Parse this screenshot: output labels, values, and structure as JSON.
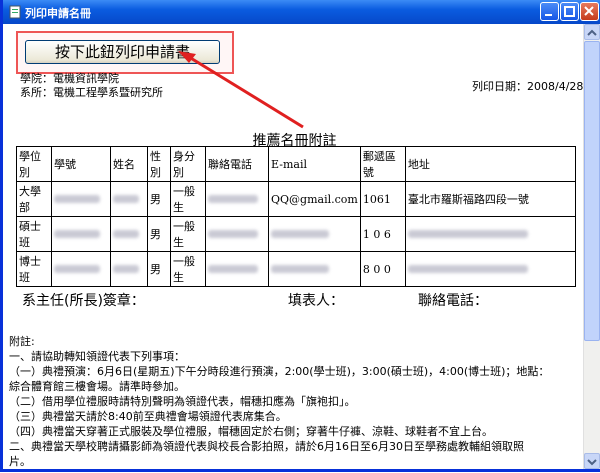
{
  "window": {
    "title": "列印申請名冊"
  },
  "print_button": {
    "label": "按下此鈕列印申請書"
  },
  "info": {
    "college": "學院：電機資訊學院",
    "department": "系所：電機工程學系暨研究所",
    "print_date": "列印日期：2008/4/28"
  },
  "table": {
    "title": "推薦名冊附註",
    "headers": [
      "學位別",
      "學號",
      "姓名",
      "性別",
      "身分別",
      "聯絡電話",
      "E-mail",
      "郵遞區號",
      "地址"
    ],
    "rows": [
      {
        "degree": "大學部",
        "gender": "男",
        "identity": "一般生",
        "email": "QQ@gmail.com",
        "zip": "1061",
        "address": "臺北市羅斯福路四段一號"
      },
      {
        "degree": "碩士班",
        "gender": "男",
        "identity": "一般生",
        "email": "",
        "zip": "1 0 6",
        "address": ""
      },
      {
        "degree": "博士班",
        "gender": "男",
        "identity": "一般生",
        "email": "",
        "zip": "8 0 0",
        "address": ""
      }
    ]
  },
  "signatures": {
    "chair": "系主任(所長)簽章：",
    "filler": "填表人：",
    "phone": "聯絡電話："
  },
  "notes": [
    "附註:",
    "一、請協助轉知領證代表下列事項：",
    "（一）典禮預演：6月6日(星期五)下午分時段進行預演，2:00(學士班)，3:00(碩士班)，4:00(博士班)；地點：",
    "綜合體育館三樓會場。請準時參加。",
    "（二）借用學位禮服時請特別聲明為領證代表，帽穗扣應為「旗袍扣」。",
    "（三）典禮當天請於8:40前至典禮會場領證代表席集合。",
    "（四）典禮當天穿著正式服裝及學位禮服，帽穗固定於右側；穿著牛仔褲、涼鞋、球鞋者不宜上台。",
    "二、典禮當天學校聘請攝影師為領證代表與校長合影拍照，請於6月16日至6月30日至學務處教輔組領取照",
    "片。"
  ],
  "colors": {
    "titlebar": "#0a5ce0",
    "highlight_box": "#e55555",
    "arrow": "#e02020"
  },
  "icons": {
    "app": "document-icon",
    "minimize": "minimize-icon",
    "maximize": "maximize-icon",
    "close": "close-icon"
  }
}
